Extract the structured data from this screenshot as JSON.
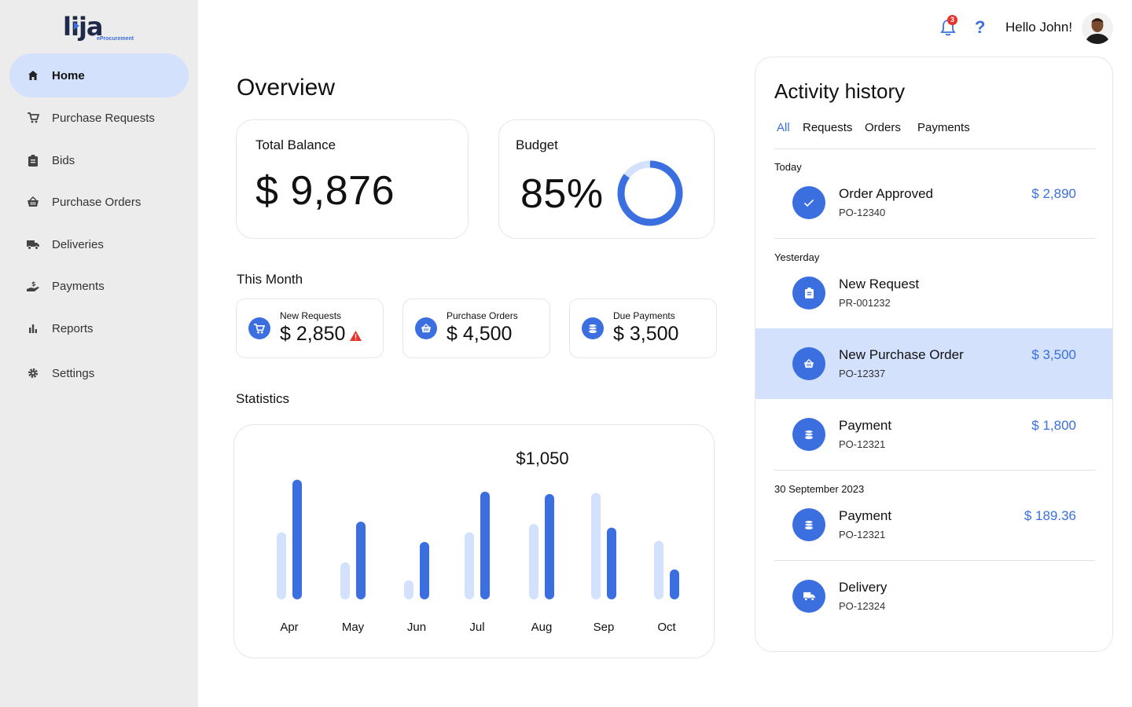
{
  "brand": {
    "logo_text": "lija",
    "logo_subtitle": "eProcurement",
    "accent": "#3b6fe0"
  },
  "sidebar": {
    "items": [
      {
        "label": "Home",
        "icon": "home-icon",
        "active": true
      },
      {
        "label": "Purchase Requests",
        "icon": "cart-icon"
      },
      {
        "label": "Bids",
        "icon": "clipboard-icon"
      },
      {
        "label": "Purchase Orders",
        "icon": "basket-icon"
      },
      {
        "label": "Deliveries",
        "icon": "truck-icon"
      },
      {
        "label": "Payments",
        "icon": "hand-coin-icon"
      },
      {
        "label": "Reports",
        "icon": "bar-chart-icon"
      },
      {
        "label": "Settings",
        "icon": "gear-icon"
      }
    ]
  },
  "topbar": {
    "notification_count": "3",
    "help_label": "?",
    "greeting": "Hello John!"
  },
  "overview": {
    "title": "Overview",
    "total_balance": {
      "label": "Total Balance",
      "value": "$ 9,876"
    },
    "budget": {
      "label": "Budget",
      "value": "85%",
      "percent": 85
    }
  },
  "this_month": {
    "title": "This Month",
    "cards": [
      {
        "label": "New Requests",
        "value": "$ 2,850",
        "icon": "cart-icon",
        "warning": true
      },
      {
        "label": "Purchase Orders",
        "value": "$ 4,500",
        "icon": "basket-icon"
      },
      {
        "label": "Due Payments",
        "value": "$ 3,500",
        "icon": "coins-icon"
      }
    ]
  },
  "statistics": {
    "title": "Statistics"
  },
  "chart_data": {
    "type": "bar",
    "title": "",
    "annotation": "$1,050",
    "categories": [
      "Apr",
      "May",
      "Jun",
      "Jul",
      "Aug",
      "Sep",
      "Oct"
    ],
    "series": [
      {
        "values": [
          560,
          310,
          160,
          560,
          630,
          890,
          490
        ],
        "color": "#d3e1fd"
      },
      {
        "values": [
          1000,
          650,
          480,
          900,
          880,
          600,
          250
        ],
        "color": "#3b6fe0"
      }
    ],
    "ylim": [
      0,
      1050
    ],
    "grid": false
  },
  "activity": {
    "title": "Activity history",
    "tabs": [
      "All",
      "Requests",
      "Orders",
      "Payments"
    ],
    "active_tab": 0,
    "groups": [
      {
        "label": "Today"
      },
      {
        "label": "Yesterday"
      },
      {
        "label": "30 September 2023"
      }
    ],
    "items": [
      {
        "name": "Order Approved",
        "ref": "PO-12340",
        "amount": "$ 2,890",
        "icon": "check-icon"
      },
      {
        "name": "New Request",
        "ref": "PR-001232",
        "amount": "",
        "icon": "clipboard-icon"
      },
      {
        "name": "New Purchase Order",
        "ref": "PO-12337",
        "amount": "$ 3,500",
        "icon": "basket-icon",
        "highlight": true
      },
      {
        "name": "Payment",
        "ref": "PO-12321",
        "amount": "$ 1,800",
        "icon": "coins-icon"
      },
      {
        "name": "Payment",
        "ref": "PO-12321",
        "amount": "$ 189.36",
        "icon": "coins-icon"
      },
      {
        "name": "Delivery",
        "ref": "PO-12324",
        "amount": "",
        "icon": "truck-icon"
      }
    ]
  }
}
